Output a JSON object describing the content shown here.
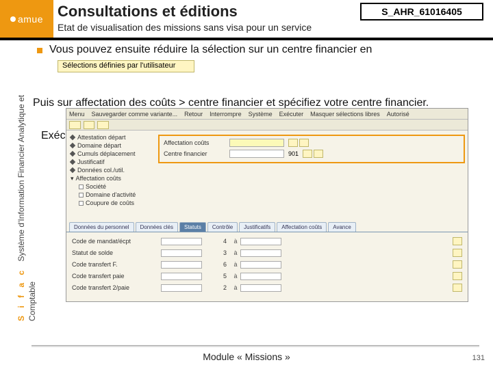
{
  "header": {
    "logo": "amue",
    "title": "Consultations et éditions",
    "subtitle": "Etat de visualisation des missions sans visa pour un service",
    "code": "S_AHR_61016405"
  },
  "sidebar": {
    "sifac": "S i f a c",
    "line1": "Système d'Information Financier Analytique et",
    "line2": "Comptable"
  },
  "bullet1": "Vous pouvez ensuite réduire la sélection sur un centre financier en",
  "userSelBtn": "Sélections définies par l'utilisateur",
  "para2": "Puis sur affectation des coûts > centre financier et spécifiez votre centre financier.",
  "exec": "Exécuter",
  "sap": {
    "menu": [
      "Menu",
      "Sauvegarder comme variante...",
      "Retour",
      "Interrompre",
      "Système",
      "Exécuter",
      "Masquer sélections libres",
      "Autorisé"
    ],
    "toolbarButtons": [
      "",
      "",
      "",
      "",
      "",
      ""
    ],
    "tree": {
      "attestation": "Attestation départ",
      "domaine_dep": "Domaine départ",
      "cumuls": "Cumuls déplacement",
      "justificatif": "Justificatif",
      "donnees_col": "Données col./util.",
      "affectation": "Affectation coûts",
      "societe": "Société",
      "domaine_act": "Domaine d'activité",
      "compte_coll": "Coupure de coûts"
    },
    "right": {
      "label1": "Affectation coûts",
      "label2": "Centre financier",
      "val2": "901"
    },
    "tabs": [
      "Données du personnel",
      "Données clés",
      "Statuts",
      "Contrôle",
      "Justificatifs",
      "Affectation coûts",
      "Avance"
    ],
    "fields": [
      {
        "label": "Code de mandat/écpt",
        "v": "4",
        "a": "à"
      },
      {
        "label": "Statut de solde",
        "v": "3",
        "a": "à"
      },
      {
        "label": "Code transfert F.",
        "v": "6",
        "a": "à"
      },
      {
        "label": "Code transfert paie",
        "v": "5",
        "a": "à"
      },
      {
        "label": "Code transfert 2/paie",
        "v": "2",
        "a": "à"
      }
    ]
  },
  "footer": {
    "module": "Module « Missions »",
    "page": "131"
  }
}
